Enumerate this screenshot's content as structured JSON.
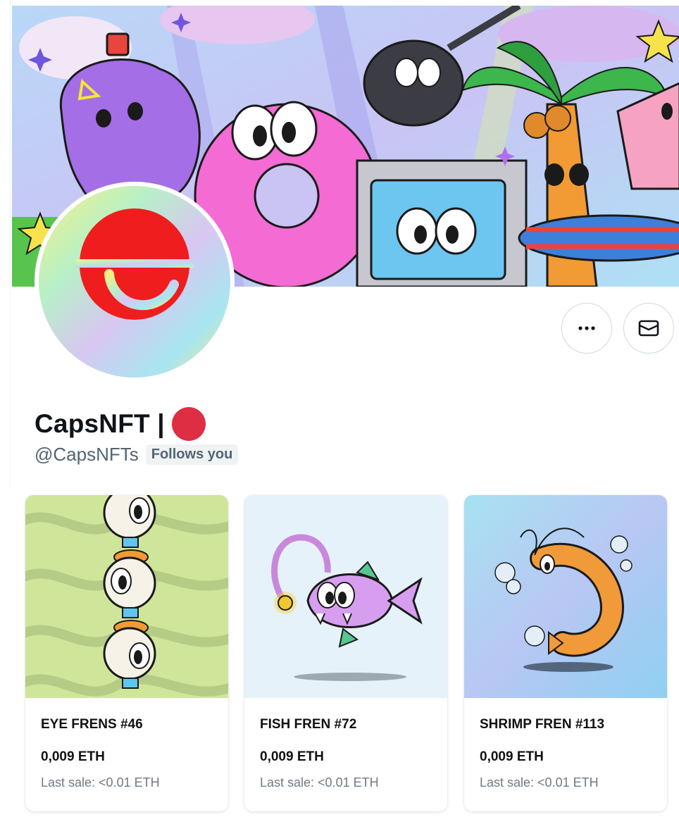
{
  "profile": {
    "display_name": "CapsNFT |",
    "handle": "@CapsNFTs",
    "follows_badge": "Follows you",
    "accent_dot_color": "#dd2e44",
    "buttons": [
      {
        "name": "more-options",
        "icon": "more-horizontal-icon"
      },
      {
        "name": "message",
        "icon": "envelope-icon"
      }
    ]
  },
  "nfts": [
    {
      "title": "EYE FRENS #46",
      "price": "0,009 ETH",
      "last_sale": "Last sale: <0.01 ETH"
    },
    {
      "title": "FISH FREN #72",
      "price": "0,009 ETH",
      "last_sale": "Last sale: <0.01 ETH"
    },
    {
      "title": "SHRIMP FREN #113",
      "price": "0,009 ETH",
      "last_sale": "Last sale: <0.01 ETH"
    }
  ]
}
